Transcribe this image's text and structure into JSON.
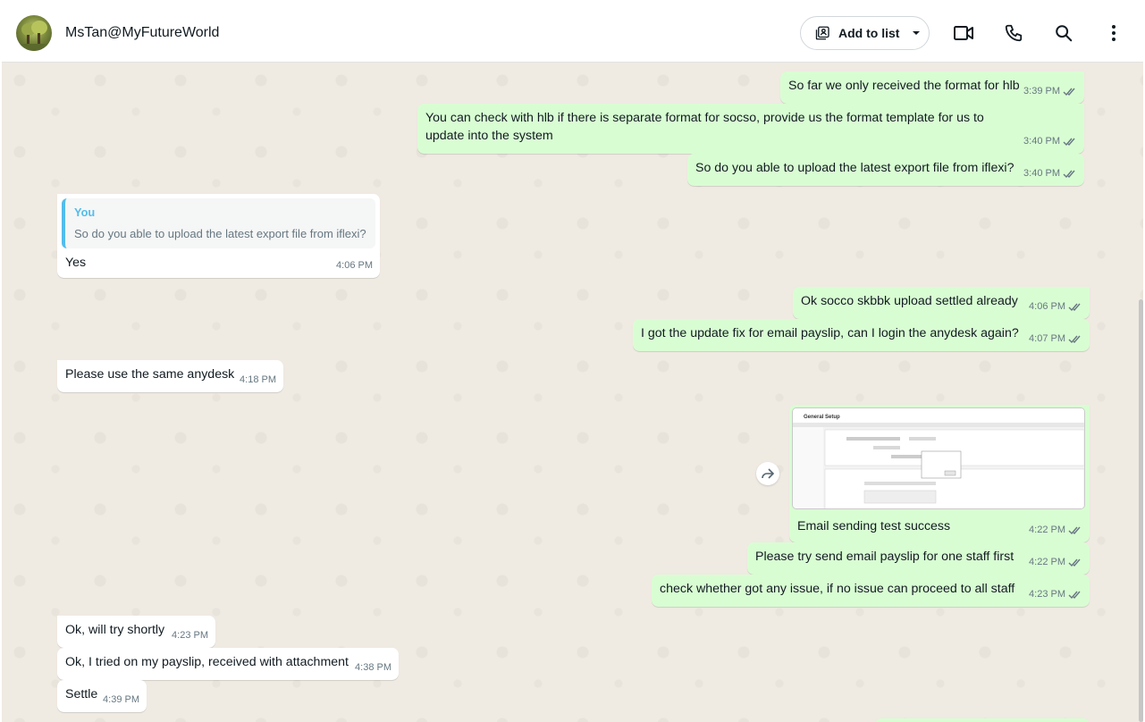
{
  "header": {
    "contact_name": "MsTan@MyFutureWorld",
    "add_to_list_label": "Add to list"
  },
  "shot": {
    "title": "General Setup"
  },
  "messages": [
    {
      "dir": "out",
      "text": "So far we only received the format for hlb",
      "time": "3:39 PM"
    },
    {
      "dir": "out",
      "text": "You can check with hlb if there is separate format for socso, provide us the format template for us to update into the system",
      "time": "3:40 PM"
    },
    {
      "dir": "out",
      "text": "So do you able to upload the latest export file from iflexi?",
      "time": "3:40 PM"
    },
    {
      "dir": "in",
      "quote_author": "You",
      "quote_text": "So do you able to upload the latest export file from iflexi?",
      "text": "Yes",
      "time": "4:06 PM"
    },
    {
      "dir": "out",
      "text": "Ok socco skbbk upload settled already",
      "time": "4:06 PM"
    },
    {
      "dir": "out",
      "text": "I got the update fix for email payslip, can I login the anydesk again?",
      "time": "4:07 PM"
    },
    {
      "dir": "in",
      "text": "Please use the same anydesk",
      "time": "4:18 PM"
    },
    {
      "dir": "out",
      "caption": "Email sending test success",
      "time": "4:22 PM"
    },
    {
      "dir": "out",
      "text": "Please try send email payslip for one staff first",
      "time": "4:22 PM"
    },
    {
      "dir": "out",
      "text": "check whether got any issue, if no issue can proceed to all staff",
      "time": "4:23 PM"
    },
    {
      "dir": "in",
      "text": "Ok, will try shortly",
      "time": "4:23 PM"
    },
    {
      "dir": "in",
      "text": "Ok, I tried on my payslip, received with attachment",
      "time": "4:38 PM"
    },
    {
      "dir": "in",
      "text": "Settle",
      "time": "4:39 PM"
    }
  ]
}
